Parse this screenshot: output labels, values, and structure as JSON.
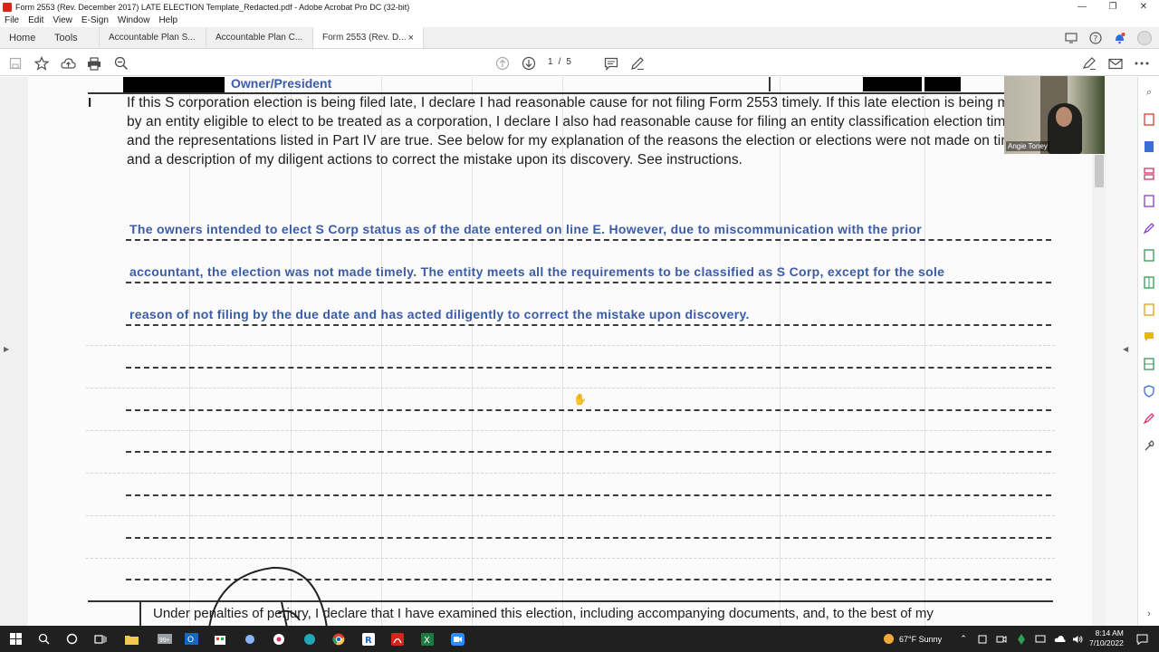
{
  "window": {
    "title": "Form 2553 (Rev. December 2017) LATE ELECTION Template_Redacted.pdf - Adobe Acrobat Pro DC (32-bit)",
    "minimize": "—",
    "maximize": "❐",
    "close": "✕"
  },
  "menu": [
    "File",
    "Edit",
    "View",
    "E-Sign",
    "Window",
    "Help"
  ],
  "tabs": {
    "home": "Home",
    "tools": "Tools",
    "docs": [
      "Accountable Plan S...",
      "Accountable Plan C...",
      "Form 2553 (Rev. D..."
    ],
    "close": "×"
  },
  "toolbar": {
    "page_current": "1",
    "page_separator": "/",
    "page_total": "5"
  },
  "document": {
    "owner_label": "Owner/President",
    "part_label": "I",
    "declaration": "If this S corporation election is being filed late, I declare I had reasonable cause for not filing Form 2553 timely. If this late election is being made by an entity eligible to elect to be treated as a corporation, I declare I also had reasonable cause for filing an entity classification election timely and the representations listed in Part IV are true. See below for my explanation of the reasons the election or elections were not made on time and a description of my diligent actions to correct the mistake upon its discovery. See instructions.",
    "explanation_lines": [
      "The owners intended to elect S Corp status as of the date entered on line E. However, due to miscommunication with the prior",
      "accountant, the election was not made timely. The entity meets all the requirements to be classified as S Corp, except for the sole",
      "reason of not filing by the due date and has acted diligently to correct the mistake upon discovery."
    ],
    "perjury_text": "Under penalties of perjury, I declare that I have examined this election, including accompanying documents, and, to the best of my"
  },
  "webcam": {
    "name": "Angie Toney"
  },
  "taskbar": {
    "weather": "67°F  Sunny",
    "time": "8:14 AM",
    "date": "7/10/2022",
    "badge": "99+"
  },
  "colors": {
    "handwriting": "#3b5ca6",
    "acrobat_red": "#d9241c",
    "taskbar": "#202020"
  }
}
